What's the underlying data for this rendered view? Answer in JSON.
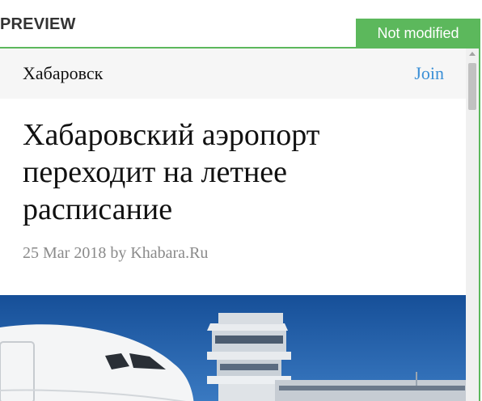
{
  "preview": {
    "label": "PREVIEW",
    "status": "Not modified"
  },
  "site": {
    "name": "Хабаровск",
    "join_label": "Join"
  },
  "article": {
    "title": "Хабаровский аэропорт переходит на летнее расписание",
    "date": "25 Mar 2018",
    "by": "by",
    "author": "Khabara.Ru"
  },
  "colors": {
    "accent": "#5cb85c",
    "link": "#3a8fd6",
    "sky": "#1f5ea8"
  }
}
